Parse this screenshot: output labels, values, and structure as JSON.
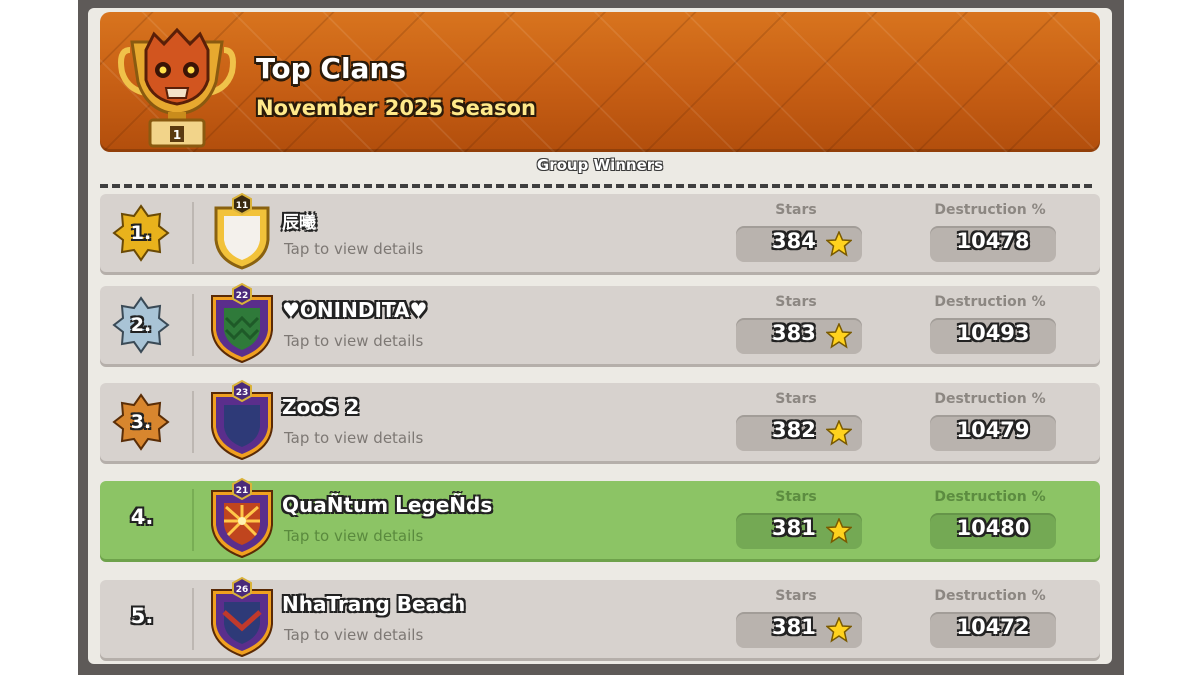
{
  "header": {
    "title": "Top Clans",
    "subtitle": "November 2025 Season",
    "trophy_rank": "1",
    "trophy_icon": "skull-trophy-icon",
    "color": "#c65e14"
  },
  "section_label": "Group Winners",
  "columns": {
    "stars": "Stars",
    "destruction": "Destruction %"
  },
  "rows": [
    {
      "rank": "1.",
      "rank_style": "gold-badge",
      "clan_level": "11",
      "name": "辰曦",
      "tap": "Tap to view details",
      "stars": "384",
      "destruction": "10478",
      "highlight": false
    },
    {
      "rank": "2.",
      "rank_style": "silver-badge",
      "clan_level": "22",
      "name": "♥ONINDITA♥",
      "tap": "Tap to view details",
      "stars": "383",
      "destruction": "10493",
      "highlight": false
    },
    {
      "rank": "3.",
      "rank_style": "bronze-badge",
      "clan_level": "23",
      "name": "ZooS 2",
      "tap": "Tap to view details",
      "stars": "382",
      "destruction": "10479",
      "highlight": false
    },
    {
      "rank": "4.",
      "rank_style": "plain",
      "clan_level": "21",
      "name": "QuaÑtum LegeÑds",
      "tap": "Tap to view details",
      "stars": "381",
      "destruction": "10480",
      "highlight": true
    },
    {
      "rank": "5.",
      "rank_style": "plain",
      "clan_level": "26",
      "name": "NhaTrang Beach",
      "tap": "Tap to view details",
      "stars": "381",
      "destruction": "10472",
      "highlight": false
    }
  ],
  "colors": {
    "highlight_row": "#8cc465",
    "row": "#d7d2ce",
    "panel": "#eceae4"
  }
}
